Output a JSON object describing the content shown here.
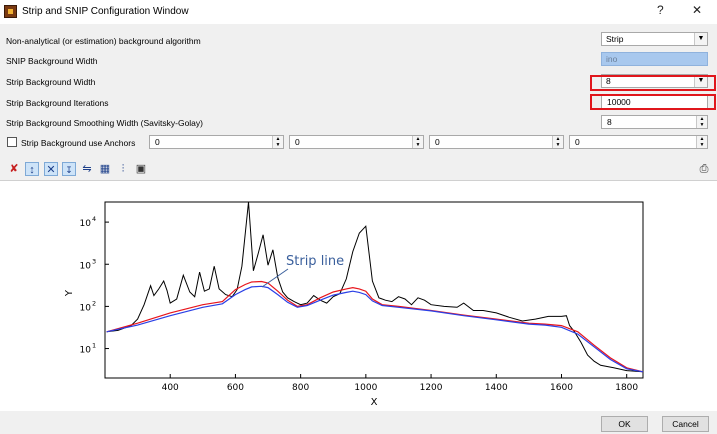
{
  "window": {
    "title": "Strip and SNIP Configuration Window",
    "help_label": "?",
    "close_label": "✕"
  },
  "form": {
    "algorithm_label": "Non-analytical (or estimation) background algorithm",
    "algorithm_value": "Strip",
    "snip_width_label": "SNIP Background Width",
    "snip_width_value": "ino",
    "strip_width_label": "Strip Background Width",
    "strip_width_value": "8",
    "strip_iterations_label": "Strip Background Iterations",
    "strip_iterations_value": "10000",
    "smoothing_label": "Strip Background Smoothing Width (Savitsky-Golay)",
    "smoothing_value": "8",
    "anchors_label": "Strip Background use Anchors",
    "anchors": [
      "0",
      "0",
      "0",
      "0"
    ]
  },
  "toolbar": {
    "icons": [
      "reset-zoom-icon",
      "y-autoscale-icon",
      "x-autoscale-icon",
      "y-log-icon",
      "legend-icon",
      "grid-icon",
      "curve-marker-icon",
      "save-icon"
    ],
    "print_icon": "print-icon"
  },
  "chart_data": {
    "type": "line",
    "xlabel": "X",
    "ylabel": "Y",
    "y_scale": "log",
    "xlim": [
      200,
      1850
    ],
    "ylim": [
      2,
      30000
    ],
    "x_ticks": [
      400,
      600,
      800,
      1000,
      1200,
      1400,
      1600,
      1800
    ],
    "y_ticks": [
      {
        "value": 10,
        "label": "10",
        "sup": "1"
      },
      {
        "value": 100,
        "label": "10",
        "sup": "2"
      },
      {
        "value": 1000,
        "label": "10",
        "sup": "3"
      },
      {
        "value": 10000,
        "label": "10",
        "sup": "4"
      }
    ],
    "annotation": "Strip line",
    "colors": {
      "spectrum": "#000000",
      "strip_red": "#e8141b",
      "strip_blue": "#2a3fe6",
      "annotation": "#3a5f9c"
    },
    "series": [
      {
        "key": "spectrum",
        "x": [
          205,
          240,
          280,
          300,
          320,
          340,
          350,
          365,
          380,
          390,
          400,
          420,
          440,
          460,
          475,
          490,
          505,
          520,
          535,
          550,
          570,
          590,
          605,
          620,
          640,
          655,
          670,
          685,
          700,
          715,
          730,
          745,
          760,
          780,
          800,
          820,
          840,
          860,
          880,
          900,
          920,
          940,
          960,
          980,
          1000,
          1020,
          1040,
          1060,
          1080,
          1100,
          1120,
          1140,
          1160,
          1180,
          1200,
          1240,
          1280,
          1300,
          1330,
          1360,
          1400,
          1440,
          1480,
          1520,
          1560,
          1600,
          1615,
          1625,
          1640,
          1660,
          1680,
          1700,
          1720,
          1760,
          1800,
          1850
        ],
        "y": [
          25,
          27,
          35,
          50,
          110,
          310,
          180,
          260,
          400,
          240,
          120,
          150,
          550,
          220,
          170,
          650,
          230,
          260,
          900,
          260,
          190,
          170,
          250,
          900,
          30000,
          700,
          1800,
          5000,
          950,
          2200,
          480,
          220,
          160,
          130,
          110,
          120,
          180,
          140,
          120,
          170,
          200,
          450,
          2000,
          5500,
          8000,
          400,
          160,
          140,
          130,
          170,
          150,
          110,
          160,
          140,
          110,
          100,
          95,
          120,
          80,
          80,
          70,
          55,
          45,
          50,
          58,
          58,
          60,
          35,
          25,
          14,
          7,
          5,
          4,
          3.5,
          3,
          2.8
        ]
      },
      {
        "key": "strip_red",
        "x": [
          205,
          300,
          400,
          500,
          560,
          600,
          630,
          650,
          680,
          700,
          730,
          760,
          790,
          820,
          860,
          900,
          940,
          960,
          980,
          1000,
          1020,
          1050,
          1100,
          1200,
          1300,
          1400,
          1500,
          1550,
          1600,
          1650,
          1700,
          1750,
          1800,
          1850
        ],
        "y": [
          25,
          40,
          70,
          110,
          130,
          250,
          330,
          380,
          390,
          360,
          230,
          140,
          100,
          110,
          160,
          220,
          260,
          280,
          260,
          230,
          150,
          110,
          100,
          80,
          62,
          50,
          40,
          38,
          35,
          25,
          12,
          6,
          3.5,
          2.8
        ]
      },
      {
        "key": "strip_blue",
        "x": [
          205,
          300,
          400,
          500,
          560,
          600,
          630,
          650,
          680,
          700,
          730,
          760,
          790,
          820,
          860,
          900,
          940,
          960,
          980,
          1000,
          1020,
          1050,
          1100,
          1200,
          1300,
          1400,
          1500,
          1550,
          1600,
          1650,
          1700,
          1750,
          1800,
          1850
        ],
        "y": [
          25,
          36,
          60,
          95,
          115,
          190,
          250,
          290,
          300,
          280,
          190,
          125,
          95,
          105,
          140,
          185,
          215,
          230,
          215,
          190,
          135,
          105,
          95,
          78,
          60,
          48,
          38,
          36,
          32,
          22,
          11,
          5.5,
          3.3,
          2.8
        ]
      }
    ]
  },
  "buttons": {
    "ok": "OK",
    "cancel": "Cancel"
  }
}
